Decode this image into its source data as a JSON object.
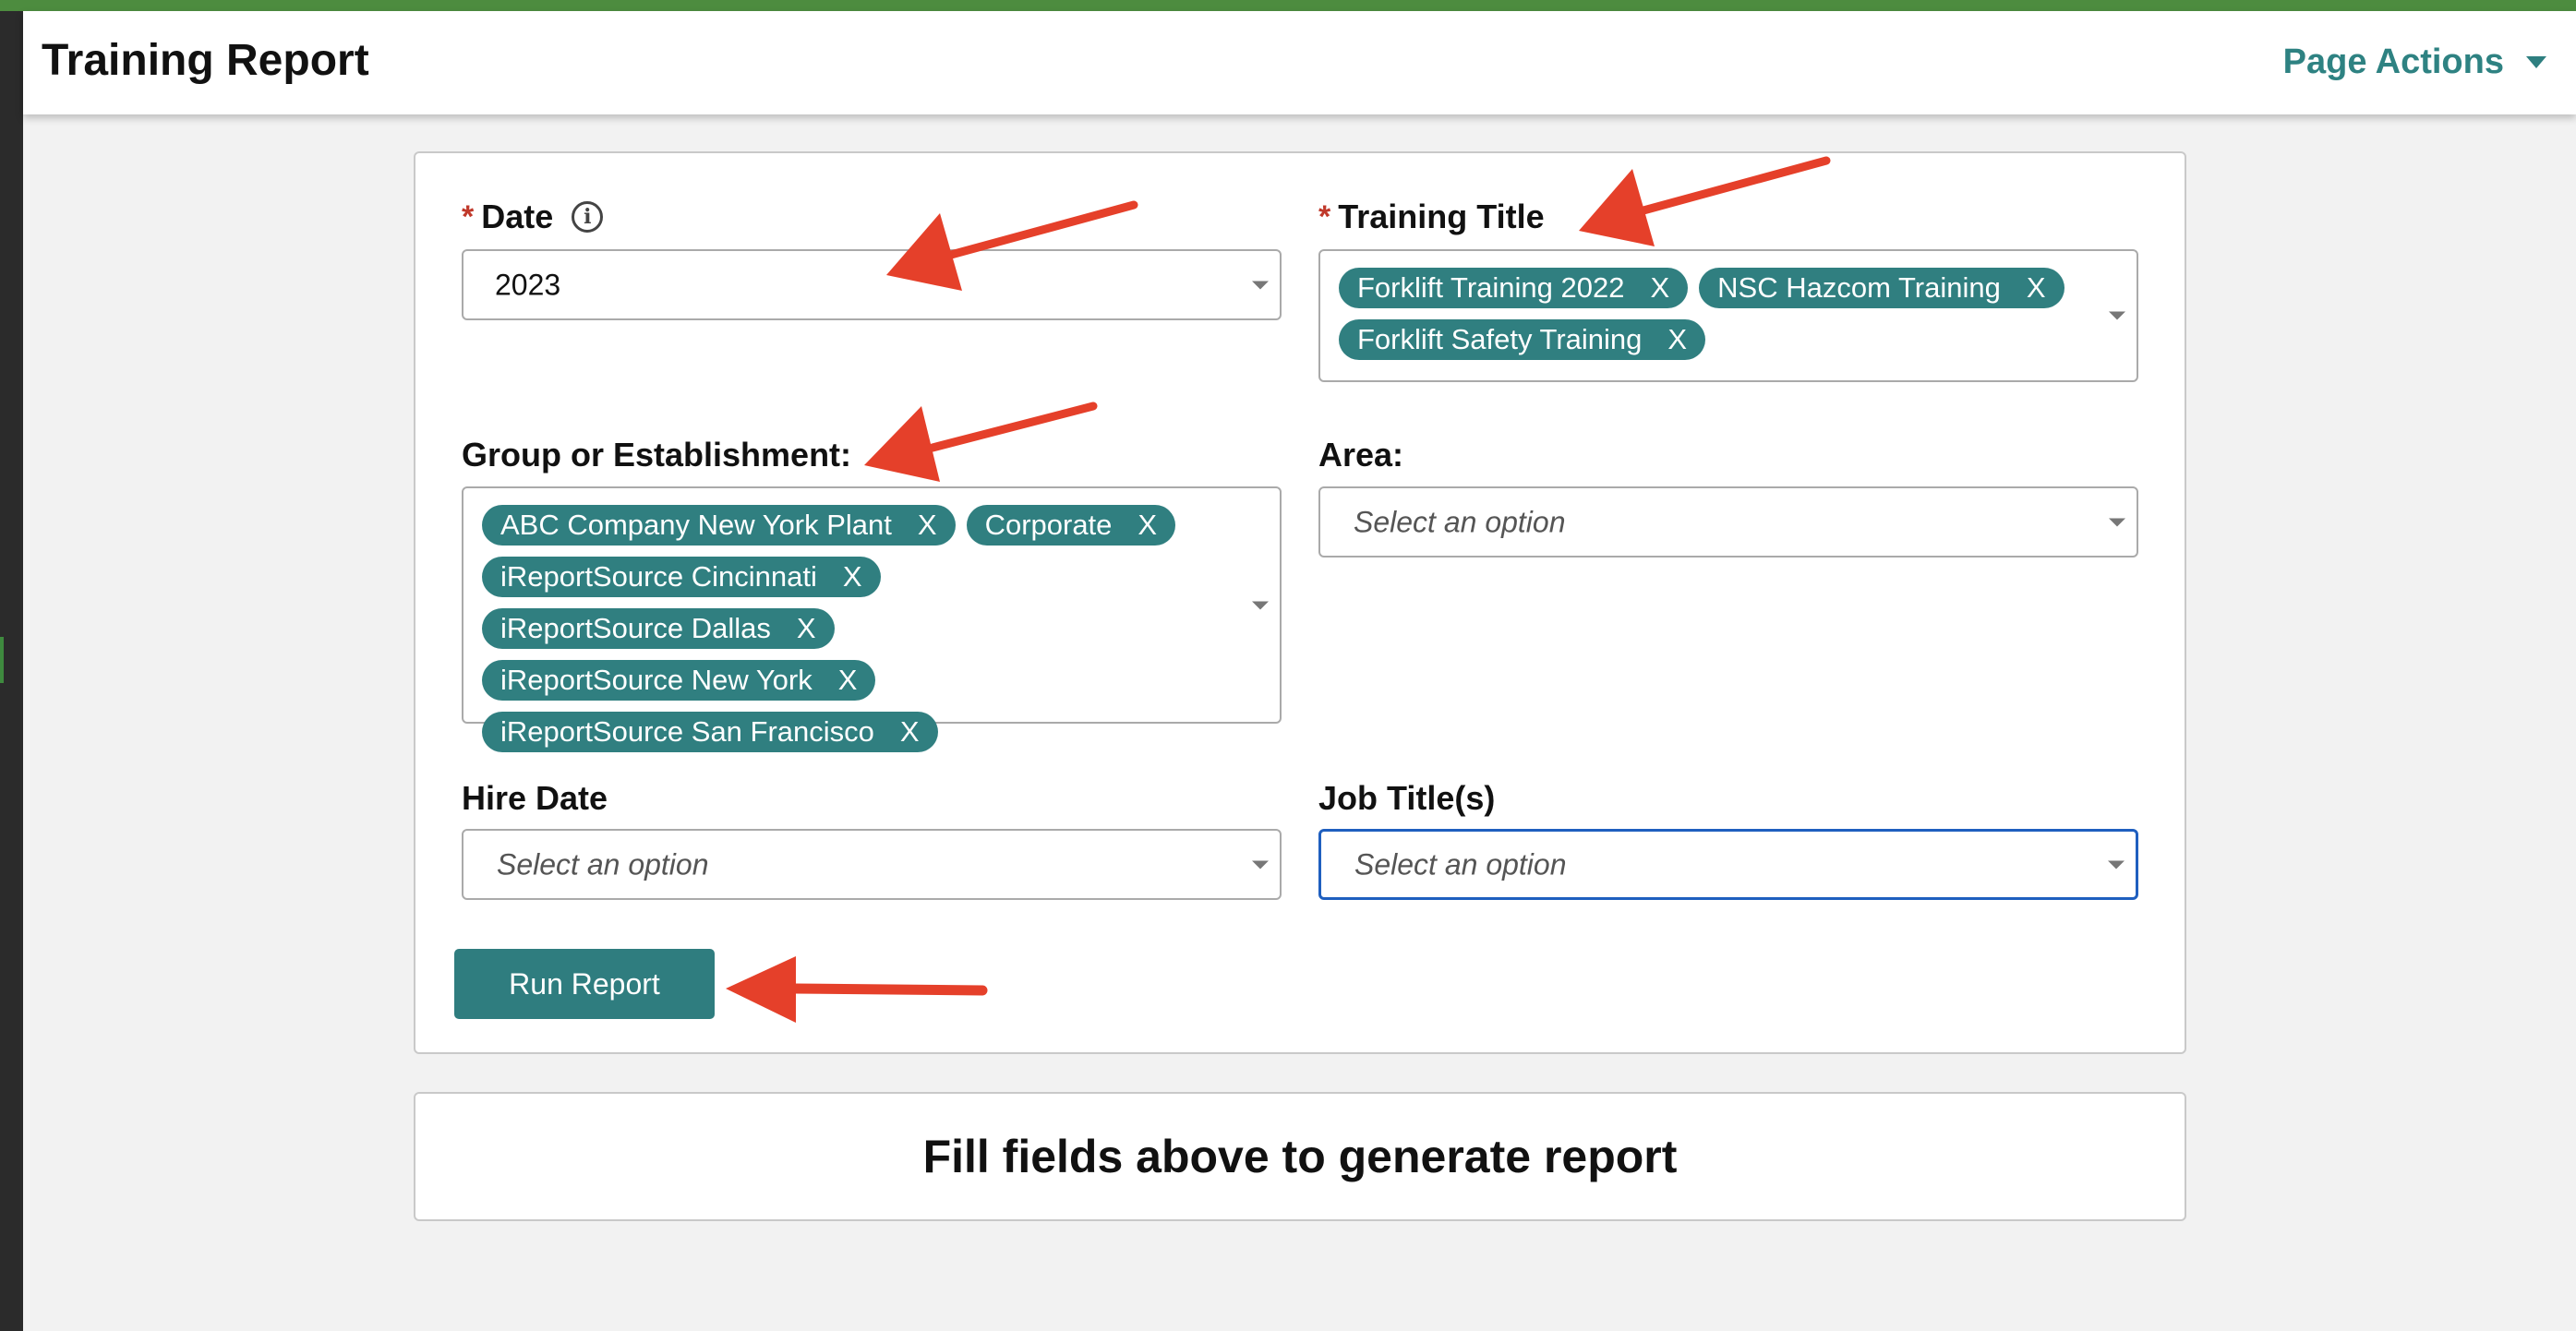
{
  "header": {
    "title": "Training Report",
    "page_actions_label": "Page Actions"
  },
  "form": {
    "date": {
      "required_mark": "*",
      "label": "Date",
      "info_glyph": "i",
      "value": "2023"
    },
    "training_title": {
      "required_mark": "*",
      "label": "Training Title",
      "tags": [
        "Forklift Training 2022",
        "NSC Hazcom Training",
        "Forklift Safety Training"
      ]
    },
    "group": {
      "label": "Group or Establishment:",
      "tags": [
        "ABC Company New York Plant",
        "Corporate",
        "iReportSource Cincinnati",
        "iReportSource Dallas",
        "iReportSource New York",
        "iReportSource San Francisco"
      ]
    },
    "area": {
      "label": "Area:",
      "placeholder": "Select an option"
    },
    "hire_date": {
      "label": "Hire Date",
      "placeholder": "Select an option"
    },
    "job_titles": {
      "label": "Job Title(s)",
      "placeholder": "Select an option"
    },
    "tag_remove_glyph": "X",
    "run_button_label": "Run Report"
  },
  "result": {
    "message": "Fill fields above to generate report"
  },
  "icons": {
    "info": "info-circle-icon",
    "dropdown": "chevron-down-icon",
    "annotation": "red-arrow-icon"
  },
  "colors": {
    "brand_green": "#4d8c3f",
    "teal": "#2e8282",
    "tag_bg": "#307f80",
    "required": "#c0392b",
    "focus_border": "#1f5fbf",
    "annotation_red": "#e5402a"
  }
}
